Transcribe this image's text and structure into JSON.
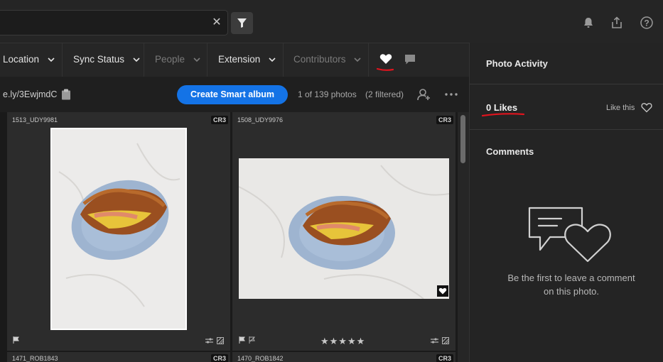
{
  "search": {
    "clear_icon": "close-icon"
  },
  "filter_bar": {
    "items": [
      {
        "label": "Location",
        "enabled": true
      },
      {
        "label": "Sync Status",
        "enabled": true
      },
      {
        "label": "People",
        "enabled": false
      },
      {
        "label": "Extension",
        "enabled": true
      },
      {
        "label": "Contributors",
        "enabled": false
      }
    ]
  },
  "toolbar": {
    "link_text": "e.ly/3EwjmdC",
    "create_button": "Create Smart album",
    "photo_count": "1 of 139 photos",
    "filtered": "(2 filtered)"
  },
  "grid": {
    "cells": [
      {
        "name": "1513_UDY9981",
        "badge": "CR3"
      },
      {
        "name": "1508_UDY9976",
        "badge": "CR3"
      },
      {
        "name": "1471_ROB1843",
        "badge": "CR3"
      },
      {
        "name": "1470_ROB1842",
        "badge": "CR3"
      }
    ],
    "stars": "★★★★★"
  },
  "panel": {
    "title": "Photo Activity",
    "likes": "0 Likes",
    "like_this": "Like this",
    "comments_title": "Comments",
    "empty_line1": "Be the first to leave a comment",
    "empty_line2": "on this photo."
  },
  "colors": {
    "accent": "#1473e6",
    "annotation": "#e0141e"
  }
}
